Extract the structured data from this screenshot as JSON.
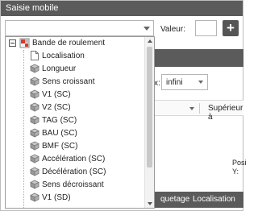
{
  "window": {
    "title": "Saisie mobile"
  },
  "toolbar": {
    "valeur_label": "Valeur:",
    "valeur_value": "",
    "add_label": "+"
  },
  "background": {
    "x_label": "x:",
    "infini_value": "infini",
    "column_header_label": "Supérieur à",
    "posi_label": "Posi",
    "y_label": "Y:",
    "bottom_tabs": [
      "quetage",
      "Localisation"
    ]
  },
  "tree": {
    "root_label": "Bande de roulement",
    "root_expanded": true,
    "items": [
      {
        "label": "Localisation",
        "icon": "document-icon"
      },
      {
        "label": "Longueur",
        "icon": "cube-icon"
      },
      {
        "label": "Sens croissant",
        "icon": "cube-icon"
      },
      {
        "label": "V1 (SC)",
        "icon": "cube-icon"
      },
      {
        "label": "V2 (SC)",
        "icon": "cube-icon"
      },
      {
        "label": "TAG (SC)",
        "icon": "cube-icon"
      },
      {
        "label": "BAU (SC)",
        "icon": "cube-icon"
      },
      {
        "label": "BMF (SC)",
        "icon": "cube-icon"
      },
      {
        "label": "Accélération (SC)",
        "icon": "cube-icon"
      },
      {
        "label": "Décélération (SC)",
        "icon": "cube-icon"
      },
      {
        "label": "Sens décroissant",
        "icon": "cube-icon"
      },
      {
        "label": "V1 (SD)",
        "icon": "cube-icon"
      }
    ]
  },
  "colors": {
    "header_bg": "#5b5b5b",
    "header_text": "#ffffff",
    "root_icon_red": "#d93a2b",
    "cube_icon": "#8a8a8a"
  }
}
